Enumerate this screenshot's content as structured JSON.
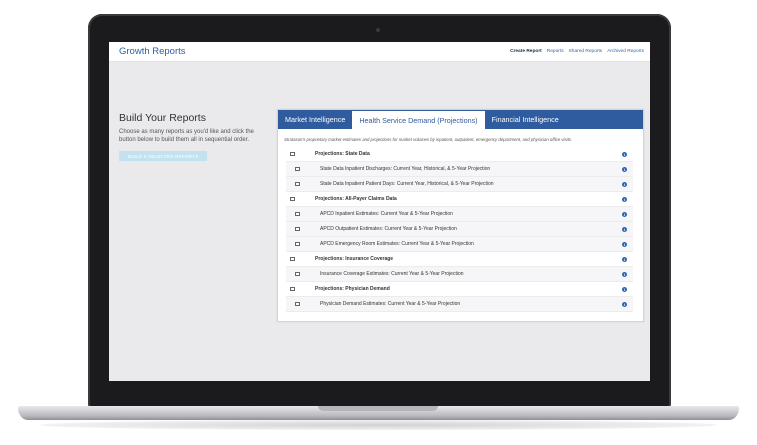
{
  "header": {
    "brand": "Growth Reports",
    "nav": [
      "Create Report",
      "Reports",
      "Shared Reports",
      "Archived Reports"
    ]
  },
  "left": {
    "title": "Build Your Reports",
    "description": "Choose as many reports as you'd like and click the button below to build them all in sequential order.",
    "button_label": "BUILD 0 SELECTED REPORTS"
  },
  "tabs": [
    "Market Intelligence",
    "Health Service Demand (Projections)",
    "Financial Intelligence"
  ],
  "intro": "Stratasan's proprietary market estimates and projections for market volumes by inpatient, outpatient, emergency department, and physician office visits.",
  "rows": [
    {
      "label": "Projections: State Data",
      "level": "parent"
    },
    {
      "label": "State Data Inpatient Discharges: Current Year, Historical, & 5-Year Projection",
      "level": "child"
    },
    {
      "label": "State Data Inpatient Patient Days: Current Year, Historical, & 5-Year Projection",
      "level": "child"
    },
    {
      "label": "Projections: All-Payer Claims Data",
      "level": "parent"
    },
    {
      "label": "APCD Inpatient Estimates: Current Year & 5-Year Projection",
      "level": "child"
    },
    {
      "label": "APCD Outpatient Estimates: Current Year & 5-Year Projection",
      "level": "child"
    },
    {
      "label": "APCD Emergency Room Estimates: Current Year & 5-Year Projection",
      "level": "child"
    },
    {
      "label": "Projections: Insurance Coverage",
      "level": "parent"
    },
    {
      "label": "Insurance Coverage Estimates: Current Year & 5-Year Projection",
      "level": "child"
    },
    {
      "label": "Projections: Physician Demand",
      "level": "parent"
    },
    {
      "label": "Physician Demand Estimates: Current Year & 5-Year Projection",
      "level": "child"
    }
  ],
  "info_glyph": "i",
  "colors": {
    "brand": "#2f5fa0",
    "tab_bar": "#2f5b9f",
    "info": "#2f66b5",
    "button_disabled": "#c3e2ef"
  }
}
